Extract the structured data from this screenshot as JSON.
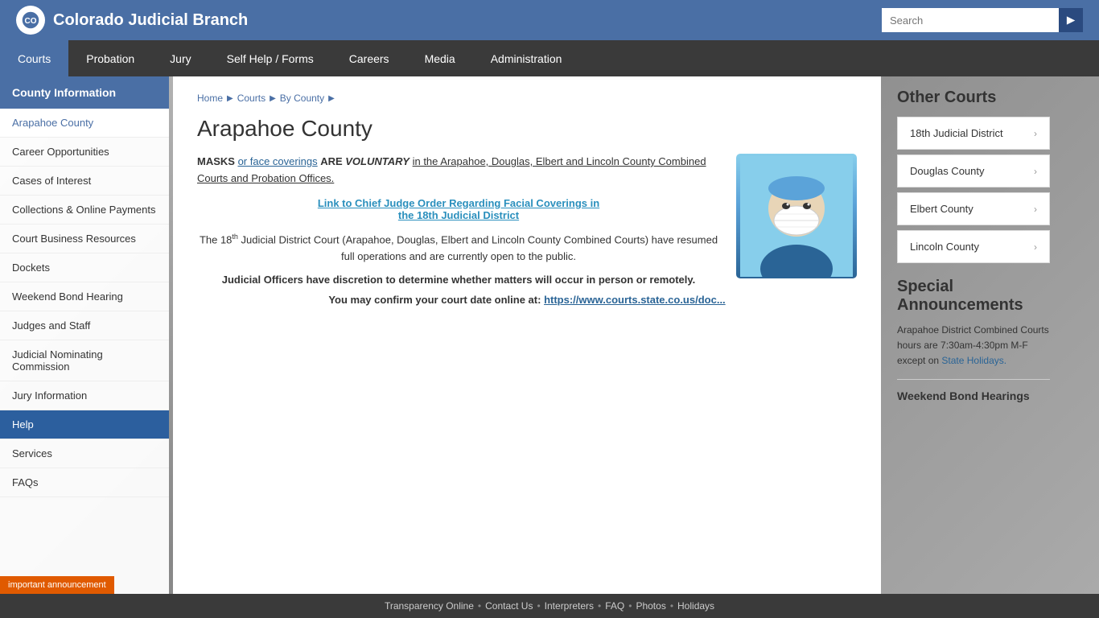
{
  "header": {
    "logo_icon": "🏛",
    "title": "Colorado Judicial Branch",
    "search_placeholder": "Search",
    "search_btn_icon": "▶"
  },
  "nav": {
    "items": [
      {
        "label": "Courts",
        "active": true
      },
      {
        "label": "Probation",
        "active": false
      },
      {
        "label": "Jury",
        "active": false
      },
      {
        "label": "Self Help / Forms",
        "active": false
      },
      {
        "label": "Careers",
        "active": false
      },
      {
        "label": "Media",
        "active": false
      },
      {
        "label": "Administration",
        "active": false
      }
    ]
  },
  "sidebar": {
    "header": "County Information",
    "items": [
      {
        "label": "Arapahoe County",
        "top": true,
        "active": false
      },
      {
        "label": "Career Opportunities",
        "active": false
      },
      {
        "label": "Cases of Interest",
        "active": false
      },
      {
        "label": "Collections & Online Payments",
        "active": false
      },
      {
        "label": "Court Business Resources",
        "active": false
      },
      {
        "label": "Dockets",
        "active": false
      },
      {
        "label": "Weekend Bond Hearing",
        "active": false
      },
      {
        "label": "Judges and Staff",
        "active": false
      },
      {
        "label": "Judicial Nominating Commission",
        "active": false
      },
      {
        "label": "Jury Information",
        "active": false
      },
      {
        "label": "Help",
        "active": true
      },
      {
        "label": "Services",
        "active": false
      },
      {
        "label": "FAQs",
        "active": false
      }
    ]
  },
  "breadcrumb": {
    "items": [
      "Home",
      "Courts",
      "By County"
    ]
  },
  "main": {
    "title": "Arapahoe County",
    "masks_text_before": "MASKS ",
    "masks_link_text": "or face coverings",
    "masks_text_middle": " ARE ",
    "masks_bold_italic": "VOLUNTARY",
    "masks_text_after": " in the Arapahoe, Douglas, Elbert and Lincoln County Combined Courts and Probation Offices.",
    "chief_judge_link": "Link to Chief Judge Order Regarding Facial Coverings in the 18th Judicial District",
    "para1_before": "The 18",
    "para1_sup": "th",
    "para1_after": " Judicial District Court (Arapahoe, Douglas, Elbert and Lincoln County Combined Courts) have resumed full operations and are currently open to the public.",
    "para2": "Judicial Officers have discretion to determine whether matters will occur in person or remotely.",
    "para3_before": "You may confirm your court date online at: ",
    "para3_link": "https://www.courts.state.co.us/doc..."
  },
  "right_sidebar": {
    "other_courts_title": "Other Courts",
    "court_items": [
      {
        "label": "18th Judicial District"
      },
      {
        "label": "Douglas County"
      },
      {
        "label": "Elbert County"
      },
      {
        "label": "Lincoln County"
      }
    ],
    "special_ann_title": "Special Announcements",
    "ann_text_before": "Arapahoe District Combined Courts hours are 7:30am-4:30pm M-F except on ",
    "ann_link_text": "State Holidays.",
    "weekend_title": "Weekend Bond Hearings"
  },
  "footer": {
    "items": [
      {
        "label": "Transparency Online"
      },
      {
        "label": "Contact Us"
      },
      {
        "label": "Interpreters"
      },
      {
        "label": "FAQ"
      },
      {
        "label": "Photos"
      },
      {
        "label": "Holidays"
      }
    ]
  },
  "important_announcement": "important announcement"
}
